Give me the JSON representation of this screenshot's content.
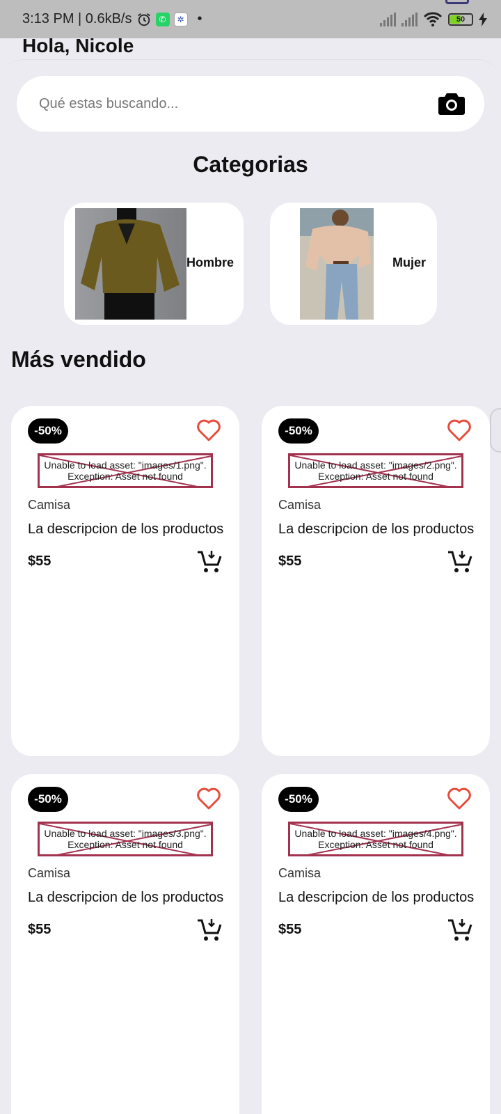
{
  "status_bar": {
    "time_speed": "3:13 PM | 0.6kB/s",
    "dot": "•",
    "battery_level": "50"
  },
  "header": {
    "greeting": "Hola, Nicole"
  },
  "search": {
    "placeholder": "Qué estas buscando..."
  },
  "categories": {
    "title": "Categorias",
    "items": [
      {
        "label": "Hombre"
      },
      {
        "label": "Mujer"
      }
    ]
  },
  "best_sellers": {
    "title": "Más vendido",
    "products": [
      {
        "badge": "-50%",
        "image_error": "Unable to load asset: \"images/1.png\".",
        "image_error_2": "Exception: Asset not found",
        "category": "Camisa",
        "description": "La descripcion de los productos",
        "price": "$55"
      },
      {
        "badge": "-50%",
        "image_error": "Unable to load asset: \"images/2.png\".",
        "image_error_2": "Exception: Asset not found",
        "category": "Camisa",
        "description": "La descripcion de los productos",
        "price": "$55"
      },
      {
        "badge": "-50%",
        "image_error": "Unable to load asset: \"images/3.png\".",
        "image_error_2": "Exception: Asset not found",
        "category": "Camisa",
        "description": "La descripcion de los productos",
        "price": "$55"
      },
      {
        "badge": "-50%",
        "image_error": "Unable to load asset: \"images/4.png\".",
        "image_error_2": "Exception: Asset not found",
        "category": "Camisa",
        "description": "La descripcion de los productos",
        "price": "$55"
      }
    ]
  },
  "colors": {
    "background": "#ecebf1",
    "card": "#ffffff",
    "heart": "#e74c3c",
    "badge": "#000000",
    "error_border": "#a3324f"
  },
  "icons": [
    "alarm-icon",
    "whatsapp-icon",
    "app-icon",
    "signal-icon",
    "wifi-icon",
    "battery-icon",
    "charging-icon",
    "camera-icon",
    "heart-icon",
    "add-to-cart-icon"
  ]
}
